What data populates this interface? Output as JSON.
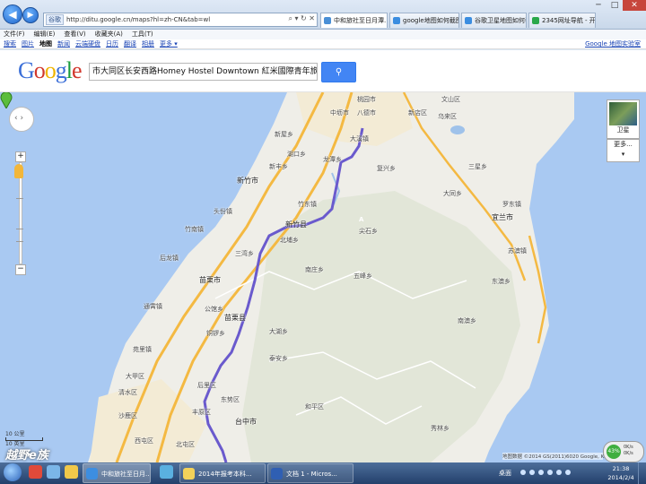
{
  "browser": {
    "address_tag": "谷歌",
    "url": "http://ditu.google.cn/maps?hl=zh-CN&tab=wl",
    "tabs": [
      {
        "label": "中和旅社至日月潭..."
      },
      {
        "label": "google地图如何截图..."
      },
      {
        "label": "谷歌卫星地图如何截..."
      },
      {
        "label": "2345网址导航 - 开创..."
      }
    ],
    "menu": [
      "文件(F)",
      "编辑(E)",
      "查看(V)",
      "收藏夹(A)",
      "工具(T)"
    ],
    "window_controls": [
      "─",
      "□",
      "✕"
    ]
  },
  "google_bar": {
    "links": [
      "搜索",
      "图片",
      "地图",
      "新闻",
      "云端硬盘",
      "日历",
      "翻译",
      "相册",
      "更多 ▾"
    ],
    "current": "地图",
    "right_link": "Google 地图实验室"
  },
  "header": {
    "logo": "Google",
    "search_value": "市大同区长安西路Homey Hostel Downtown 紅米國際青年旅館",
    "search_button_icon": "search-icon"
  },
  "map": {
    "marker_label": "A",
    "route_color": "#6a5acd",
    "labels": {
      "taoyuan_city": "桃园市",
      "wenshan": "文山区",
      "zhongli": "中坜市",
      "bade": "八德市",
      "daxi": "大溪镇",
      "longtan": "龙潭乡",
      "fuxing": "复兴乡",
      "xinwu": "新屋乡",
      "hukou": "湖口乡",
      "xinfeng": "新丰乡",
      "xinzhu_city": "新竹市",
      "zhudong": "竹东镇",
      "xinzhu_county": "新竹县",
      "jianshi": "尖石乡",
      "wufeng": "五峰乡",
      "beipu": "北埔乡",
      "toufen": "头份镇",
      "zhunan": "竹南镇",
      "sanwan": "三湾乡",
      "nanzhuang": "南庄乡",
      "miaoli_city": "苗栗市",
      "miaoli_county": "苗栗县",
      "tongluo": "铜锣乡",
      "gongguan": "公馆乡",
      "dahu": "大湖乡",
      "tai_an": "泰安乡",
      "heping": "和平区",
      "dongshi": "东势区",
      "taizhong": "台中市",
      "fengyuan": "丰原区",
      "beitun": "北屯区",
      "xitun": "西屯区",
      "dajia": "大甲区",
      "qingshui": "清水区",
      "shalu": "沙鹿区",
      "houli": "后里区",
      "yuanli": "苑里镇",
      "tongxiao": "通霄镇",
      "houlong": "后龙镇",
      "datong": "大同乡",
      "yilan": "宜兰市",
      "luodong": "罗东镇",
      "nanao": "南澳乡",
      "wulai": "乌来区",
      "xindian": "新店区",
      "sanxing": "三星乡",
      "suao": "苏澳镇",
      "xiulin": "秀林乡",
      "dongao": "东澳乡"
    },
    "attribution": "地图数据 ©2014 GS(2011)6020 Google, Kingway",
    "scale": {
      "top": "10 公里",
      "bottom": "10 英里"
    },
    "map_type": {
      "satellite": "卫星",
      "more": "更多..."
    },
    "watermark": "越野e族",
    "speed": {
      "value": "43%",
      "up": "0K/s",
      "down": "0K/s"
    }
  },
  "taskbar": {
    "items": [
      {
        "label": "中和旅社至日月..."
      },
      {
        "label": "2014年报考本科..."
      },
      {
        "label": "文档 1 - Micros..."
      }
    ],
    "tray_label": "桌面",
    "time": "21:38",
    "date": "2014/2/4"
  },
  "colors": {
    "sea": "#a9c9f2",
    "land": "#efeee8",
    "forest": "#dfe5d3",
    "highway": "#f4b942",
    "route": "#6a5acd"
  }
}
